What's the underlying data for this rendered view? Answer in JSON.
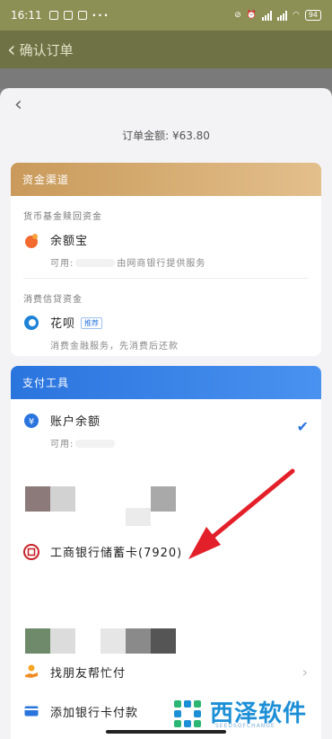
{
  "status_bar": {
    "time": "16:11",
    "dots": "···",
    "battery": "94"
  },
  "background_page": {
    "title": "确认订单"
  },
  "sheet": {
    "order_amount_label": "订单金额:",
    "order_amount_value": "¥63.80"
  },
  "funds_card": {
    "header": "资金渠道",
    "sections": [
      {
        "label": "货币基金赎回资金",
        "option": {
          "name": "余额宝",
          "sub_prefix": "可用:",
          "sub_suffix": "由网商银行提供服务",
          "icon": "yuebao-icon"
        }
      },
      {
        "label": "消费信贷资金",
        "option": {
          "name": "花呗",
          "tag": "推荐",
          "sub": "消费金融服务，先消费后还款",
          "icon": "huabei-icon"
        }
      }
    ]
  },
  "tools_card": {
    "header": "支付工具",
    "balance": {
      "name": "账户余额",
      "sub_prefix": "可用:",
      "selected": true,
      "icon": "balance-icon"
    },
    "bank_card": {
      "name": "工商银行储蓄卡(7920)",
      "icon": "icbc-icon"
    },
    "find_friend": {
      "name": "找朋友帮忙付",
      "icon": "hand-coin-icon"
    },
    "add_card": {
      "name": "添加银行卡付款",
      "icon": "card-icon"
    }
  },
  "colors": {
    "gold_header": "#c99a5a",
    "blue_header": "#2a74de",
    "arrow": "#e3202a",
    "watermark": "#1c8fd6"
  },
  "watermark": {
    "title": "西泽软件",
    "subtitle": "SEEDSOFCHANGE"
  }
}
